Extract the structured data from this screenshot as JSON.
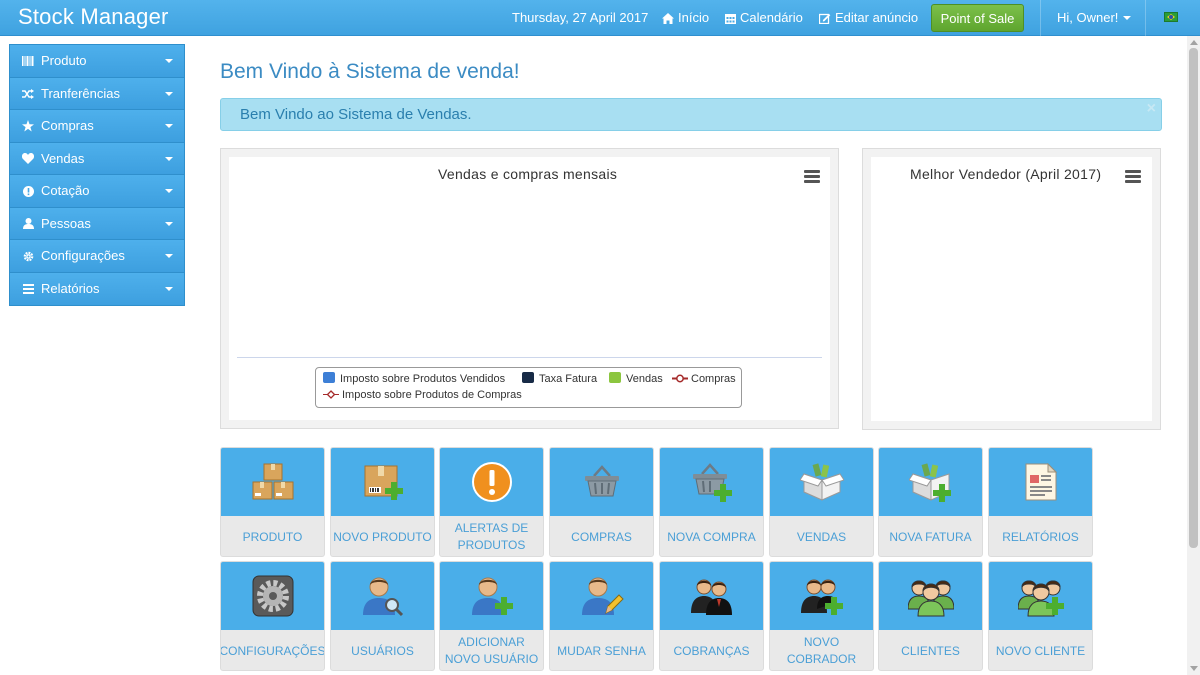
{
  "app": {
    "title": "Stock Manager"
  },
  "topbar": {
    "date": "Thursday, 27 April 2017",
    "home": "Início",
    "calendar": "Calendário",
    "edit_notice": "Editar anúncio",
    "pos": "Point of Sale",
    "user": "Hi, Owner!",
    "flag_icon": "brazil-flag-icon"
  },
  "sidebar": {
    "items": [
      {
        "label": "Produto",
        "icon": "barcode-icon"
      },
      {
        "label": "Tranferências",
        "icon": "random-icon"
      },
      {
        "label": "Compras",
        "icon": "star-icon"
      },
      {
        "label": "Vendas",
        "icon": "heart-icon"
      },
      {
        "label": "Cotação",
        "icon": "info-icon"
      },
      {
        "label": "Pessoas",
        "icon": "user-icon"
      },
      {
        "label": "Configurações",
        "icon": "cog-icon"
      },
      {
        "label": "Relatórios",
        "icon": "list-icon"
      }
    ]
  },
  "main": {
    "title": "Bem Vindo à Sistema de venda!",
    "alert": "Bem Vindo ao Sistema de Vendas.",
    "alert_close": "×"
  },
  "chart_data": [
    {
      "type": "bar",
      "title": "Vendas e compras mensais",
      "categories": [],
      "series": [
        {
          "name": "Imposto sobre Produtos Vendidos",
          "type": "bar",
          "color": "#3d7fd6",
          "values": []
        },
        {
          "name": "Taxa Fatura",
          "type": "bar",
          "color": "#172a46",
          "values": []
        },
        {
          "name": "Vendas",
          "type": "bar",
          "color": "#8cc63f",
          "values": []
        },
        {
          "name": "Compras",
          "type": "line",
          "color": "#a52a2a",
          "values": []
        },
        {
          "name": "Imposto sobre Produtos de Compras",
          "type": "line",
          "color": "#a52a2a",
          "values": []
        }
      ]
    },
    {
      "type": "pie",
      "title": "Melhor Vendedor (April 2017)",
      "values": []
    }
  ],
  "tiles": [
    {
      "label": "PRODUTO",
      "icon": "boxes-icon"
    },
    {
      "label": "NOVO PRODUTO",
      "icon": "box-add-icon"
    },
    {
      "label": "ALERTAS DE PRODUTOS",
      "icon": "alert-icon"
    },
    {
      "label": "COMPRAS",
      "icon": "basket-icon"
    },
    {
      "label": "NOVA COMPRA",
      "icon": "basket-add-icon"
    },
    {
      "label": "VENDAS",
      "icon": "sales-box-icon"
    },
    {
      "label": "NOVA FATURA",
      "icon": "sales-box-add-icon"
    },
    {
      "label": "RELATÓRIOS",
      "icon": "report-icon"
    },
    {
      "label": "CONFIGURAÇÕES",
      "icon": "settings-gear-icon"
    },
    {
      "label": "USUÁRIOS",
      "icon": "user-search-icon"
    },
    {
      "label": "ADICIONAR NOVO USUÁRIO",
      "icon": "user-add-icon"
    },
    {
      "label": "MUDAR SENHA",
      "icon": "user-edit-icon"
    },
    {
      "label": "COBRANÇAS",
      "icon": "billers-icon"
    },
    {
      "label": "NOVO COBRADOR",
      "icon": "biller-add-icon"
    },
    {
      "label": "CLIENTES",
      "icon": "customers-icon"
    },
    {
      "label": "NOVO CLIENTE",
      "icon": "customer-add-icon"
    }
  ]
}
